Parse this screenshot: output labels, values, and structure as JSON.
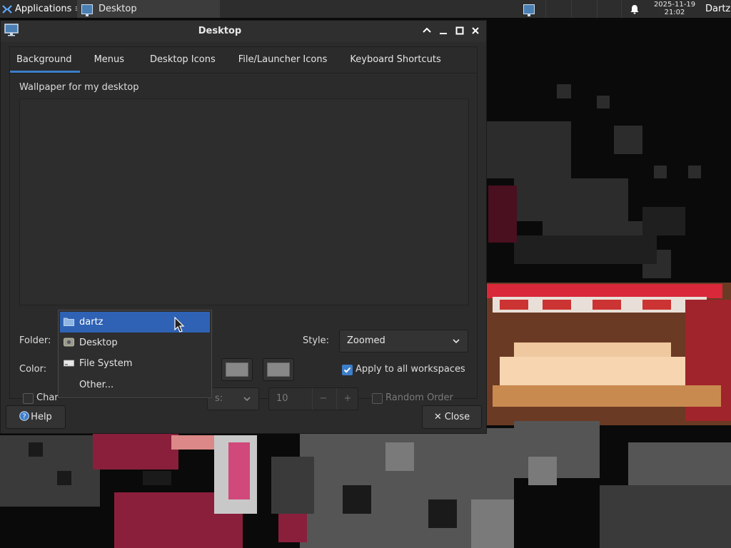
{
  "panel": {
    "applications_label": "Applications",
    "task_label": "Desktop",
    "clock_date": "2025-11-19",
    "clock_time": "21:02",
    "user": "Dartz",
    "icons": [
      "applications-logo-icon",
      "display-settings-icon",
      "bell-icon"
    ]
  },
  "window": {
    "title": "Desktop",
    "controls": [
      "shade-up-icon",
      "minimize-icon",
      "maximize-icon",
      "close-icon"
    ]
  },
  "tabs": [
    "Background",
    "Menus",
    "Desktop Icons",
    "File/Launcher Icons",
    "Keyboard Shortcuts"
  ],
  "active_tab": "Background",
  "background": {
    "wallpaper_label": "Wallpaper for my desktop",
    "folder_label": "Folder:",
    "style_label": "Style:",
    "style_value": "Zoomed",
    "color_label": "Color:",
    "apply_all_label": "Apply to all workspaces",
    "apply_all_checked": true,
    "change_label_partial": "Char",
    "interval_label_partial": "s:",
    "interval_value": "10",
    "random_order_label": "Random Order",
    "random_order_checked": false,
    "color1": "#888888",
    "color2": "#888888"
  },
  "folder_dropdown": {
    "items": [
      {
        "label": "dartz",
        "icon": "folder-icon",
        "selected": true
      },
      {
        "label": "Desktop",
        "icon": "desktop-folder-icon",
        "selected": false
      },
      {
        "label": "File System",
        "icon": "drive-icon",
        "selected": false
      },
      {
        "label": "Other...",
        "icon": "",
        "selected": false
      }
    ]
  },
  "buttons": {
    "help": "Help",
    "close": "Close"
  },
  "colors": {
    "accent": "#3d7ecb",
    "selection": "#2f62b4",
    "dialog_bg": "#2b2b2b",
    "panel_bg": "#2d2d2d"
  }
}
